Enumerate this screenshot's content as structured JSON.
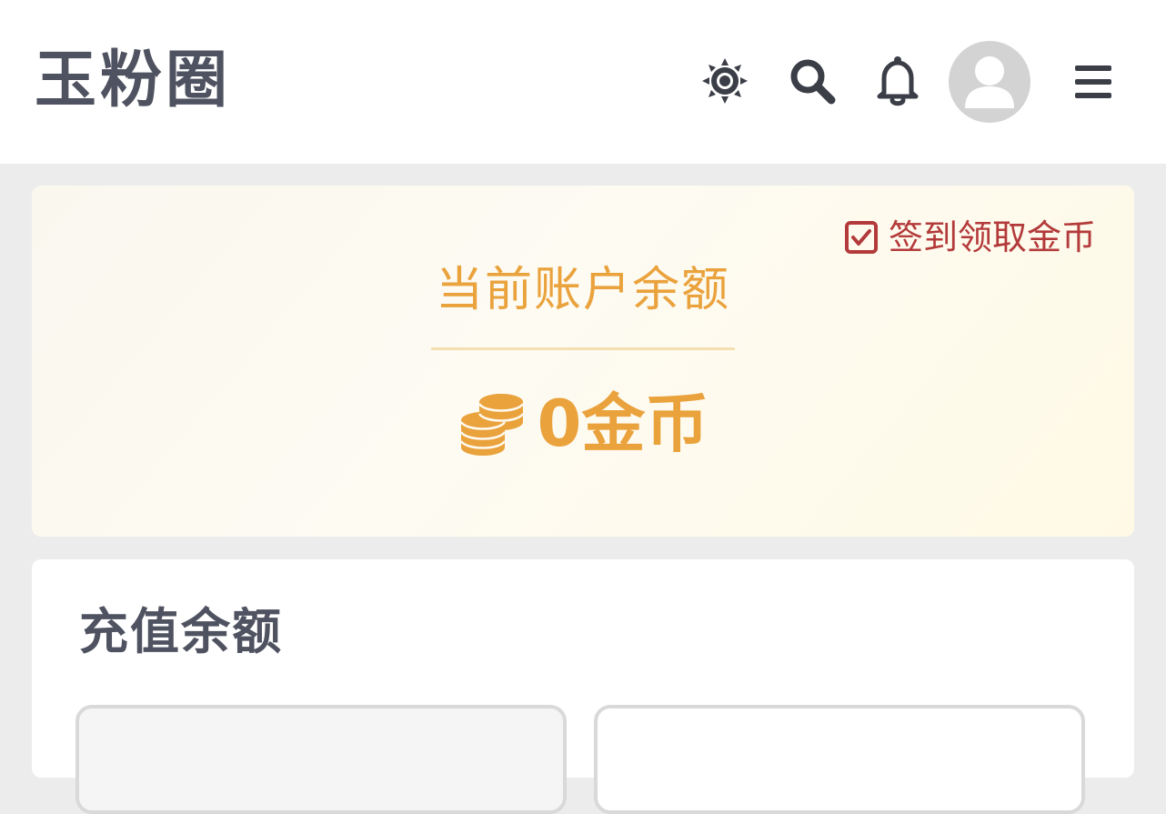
{
  "header": {
    "logo": "玉粉圈",
    "icons": [
      "sun-icon",
      "search-icon",
      "bell-icon",
      "avatar",
      "menu-icon"
    ]
  },
  "balance": {
    "checkin_label": "签到领取金币",
    "title": "当前账户余额",
    "amount": "0金币",
    "accent_color": "#eaa23c",
    "checkin_color": "#b33a3a"
  },
  "recharge": {
    "title": "充值余额"
  }
}
